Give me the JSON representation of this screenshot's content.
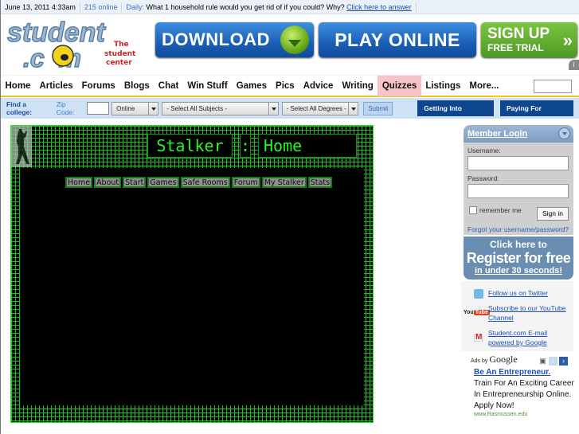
{
  "topbar": {
    "datetime": "June 13, 2011 4:33am",
    "online": "215 online",
    "daily_label": "Daily:",
    "daily_question": "What 1 household rule would you get rid of if you could? Why?",
    "daily_link": "Click here to answer"
  },
  "header": {
    "logo_text": "student.com",
    "logo_tagline": "The student center",
    "banners": {
      "download": "DOWNLOAD",
      "play_online": "PLAY ONLINE",
      "sign_up": "SIGN UP",
      "free_trial": "FREE TRIAL",
      "chevron": "»"
    },
    "ad_info": "i"
  },
  "nav": {
    "items": [
      "Home",
      "Articles",
      "Forums",
      "Blogs",
      "Chat",
      "Win Stuff",
      "Games",
      "Pics",
      "Advice",
      "Writing",
      "Quizzes",
      "Listings",
      "More..."
    ],
    "active": "Quizzes",
    "search_value": ""
  },
  "finder": {
    "label": "Find a college:",
    "zip_label": "Zip Code:",
    "zip_value": "",
    "mode": "Online",
    "subjects": "- Select All Subjects -",
    "degrees": "- Select All Degrees -",
    "submit": "Submit",
    "btn_getting_in": "Getting Into College",
    "btn_paying": "Paying For College"
  },
  "game": {
    "title_left": "Stalker",
    "title_sep": ":",
    "title_right": "Home",
    "nav": [
      "Home",
      "About",
      "Start",
      "Games",
      "Safe Rooms",
      "Forum",
      "My Stalker",
      "Stats"
    ],
    "colors": {
      "grid": "#16c716",
      "text": "#2cf22c",
      "bg": "#000000"
    }
  },
  "login": {
    "title": "Member Login",
    "username_label": "Username:",
    "username_value": "",
    "password_label": "Password:",
    "password_value": "",
    "remember": "remember me",
    "signin": "Sign in",
    "forgot": "Forgot your username/password?"
  },
  "register": {
    "line1": "Click here to",
    "line2": "Register for free",
    "line3": "in under 30 seconds!"
  },
  "social": {
    "twitter": "Follow us on Twitter",
    "youtube_icon": "YouTube",
    "youtube": "Subscribe to our YouTube Channel",
    "gmail": "Student.com E-mail powered by Google"
  },
  "ads": {
    "by": "Ads by",
    "google": "Google",
    "title": "Be An Entrepreneur.",
    "body": "Train For An Exciting Career In Entrepreneurship Online. Apply Now!",
    "url": "www.Rasmussen.edu"
  }
}
